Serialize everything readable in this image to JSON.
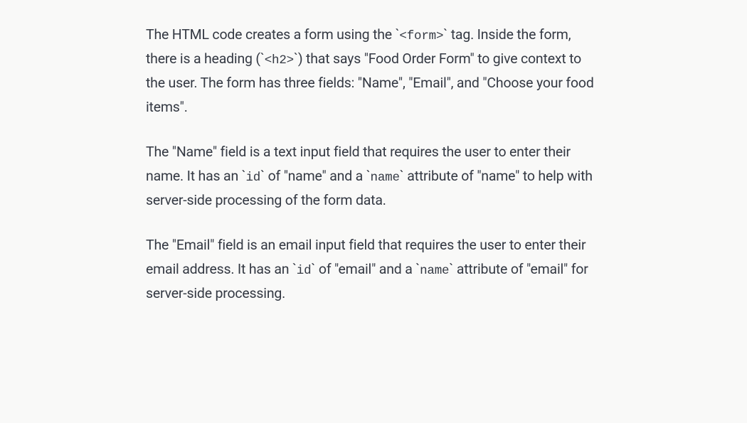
{
  "paragraphs": {
    "p1": {
      "t1": "The HTML code creates a form using the `",
      "c1": "<form>",
      "t2": "` tag. Inside the form, there is a heading (`",
      "c2": "<h2>",
      "t3": "`) that says \"Food Order Form\" to give context to the user. The form has three fields: \"Name\", \"Email\", and \"Choose your food items\"."
    },
    "p2": {
      "t1": "The \"Name\" field is a text input field that requires the user to enter their name. It has an `",
      "c1": "id",
      "t2": "` of \"name\" and a `",
      "c2": "name",
      "t3": "` attribute of \"name\" to help with server-side processing of the form data."
    },
    "p3": {
      "t1": "The \"Email\" field is an email input field that requires the user to enter their email address. It has an `",
      "c1": "id",
      "t2": "` of \"email\" and a `",
      "c2": "name",
      "t3": "` attribute of \"email\" for server-side processing."
    }
  }
}
